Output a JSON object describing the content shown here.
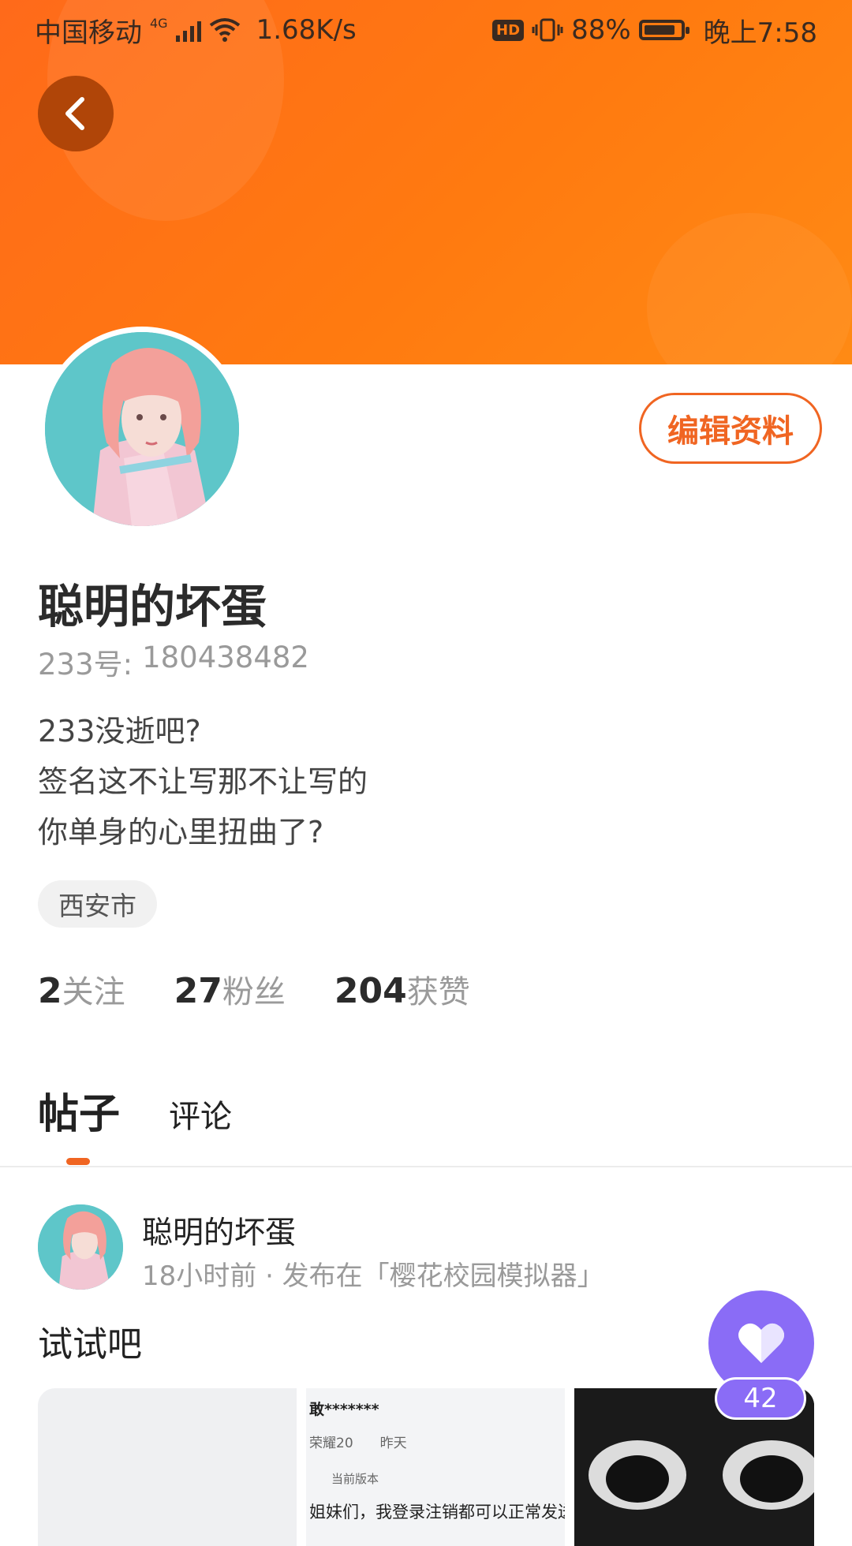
{
  "status_bar": {
    "carrier": "中国移动",
    "network": "4G",
    "speed": "1.68K/s",
    "hd_label": "HD",
    "battery_percent": "88%",
    "battery_level": 0.88,
    "time": "晚上7:58"
  },
  "profile": {
    "username": "聪明的坏蛋",
    "id_label": "233号:",
    "id_value": "180438482",
    "bio_lines": [
      "233没逝吧?",
      "签名这不让写那不让写的",
      "你单身的心里扭曲了?"
    ],
    "location": "西安市",
    "edit_button": "编辑资料",
    "stats": [
      {
        "num": "2",
        "label": "关注"
      },
      {
        "num": "27",
        "label": "粉丝"
      },
      {
        "num": "204",
        "label": "获赞"
      }
    ]
  },
  "tabs": [
    {
      "label": "帖子",
      "active": true
    },
    {
      "label": "评论",
      "active": false
    }
  ],
  "post": {
    "author": "聪明的坏蛋",
    "meta": "18小时前 · 发布在「樱花校园模拟器」",
    "title": "试试吧",
    "thumb2": {
      "name": "敢*******",
      "device": "荣耀20",
      "when": "昨天",
      "version": "当前版本",
      "body": "姐妹们，我登录注销都可以正常发送"
    }
  },
  "like": {
    "count": "42"
  },
  "colors": {
    "accent": "#f06522",
    "banner": "#ff7a10",
    "like": "#8a6cf6"
  }
}
